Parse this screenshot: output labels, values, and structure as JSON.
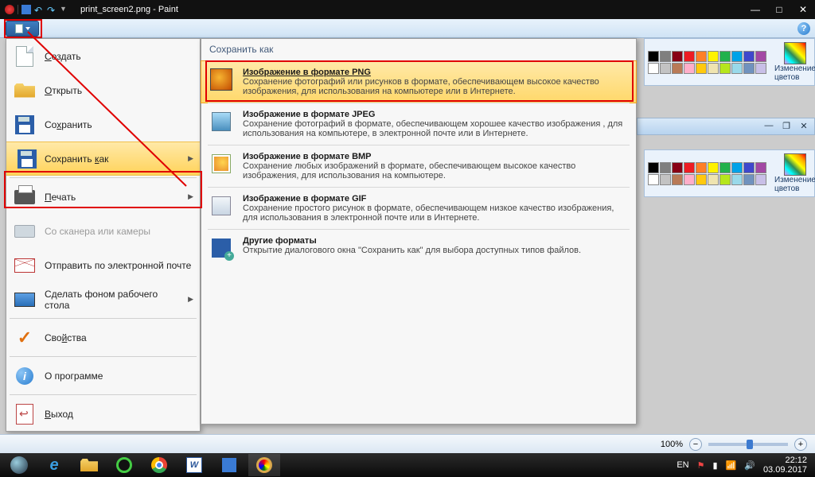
{
  "titlebar": {
    "title": "print_screen2.png - Paint"
  },
  "window_buttons": {
    "min": "—",
    "max": "□",
    "close": "✕"
  },
  "menu": {
    "items": [
      {
        "label": "Создать",
        "accesskey": "С"
      },
      {
        "label": "Открыть",
        "accesskey": "О"
      },
      {
        "label": "Сохранить",
        "accesskey": "х"
      },
      {
        "label": "Сохранить как",
        "accesskey": "к"
      },
      {
        "label": "Печать",
        "accesskey": "П"
      },
      {
        "label": "Со сканера или камеры"
      },
      {
        "label": "Отправить по электронной почте"
      },
      {
        "label": "Сделать фоном рабочего стола"
      },
      {
        "label": "Свойства",
        "accesskey": "й"
      },
      {
        "label": "О программе"
      },
      {
        "label": "Выход",
        "accesskey": "В"
      }
    ]
  },
  "submenu": {
    "header": "Сохранить как",
    "items": [
      {
        "title": "Изображение в формате PNG",
        "desc": "Сохранение фотографий или рисунков в формате, обеспечивающем высокое качество изображения, для использования на компьютере или в Интернете."
      },
      {
        "title": "Изображение в формате JPEG",
        "desc": "Сохранение фотографий в формате, обеспечивающем хорошее качество изображения , для использования на компьютере, в электронной почте или в Интернете."
      },
      {
        "title": "Изображение в формате BMP",
        "desc": "Сохранение любых изображений в формате, обеспечивающем высокое качество изображения, для использования на компьютере."
      },
      {
        "title": "Изображение в формате GIF",
        "desc": "Сохранение простого рисунок в формате, обеспечивающем низкое качество изображения, для использования в электронной почте или в Интернете."
      },
      {
        "title": "Другие форматы",
        "desc": "Открытие диалогового окна \"Сохранить как\" для выбора доступных типов файлов."
      }
    ]
  },
  "colors_panel": {
    "label": "Изменение цветов",
    "swatches": [
      "#000",
      "#7f7f7f",
      "#880015",
      "#ed1c24",
      "#ff7f27",
      "#fff200",
      "#22b14c",
      "#00a2e8",
      "#3f48cc",
      "#a349a4",
      "#fff",
      "#c3c3c3",
      "#b97a57",
      "#ffaec9",
      "#ffc90e",
      "#efe4b0",
      "#b5e61d",
      "#99d9ea",
      "#7092be",
      "#c8bfe7"
    ]
  },
  "statusbar": {
    "zoom": "100%"
  },
  "taskbar": {
    "lang": "EN",
    "time": "22:12",
    "date": "03.09.2017"
  }
}
